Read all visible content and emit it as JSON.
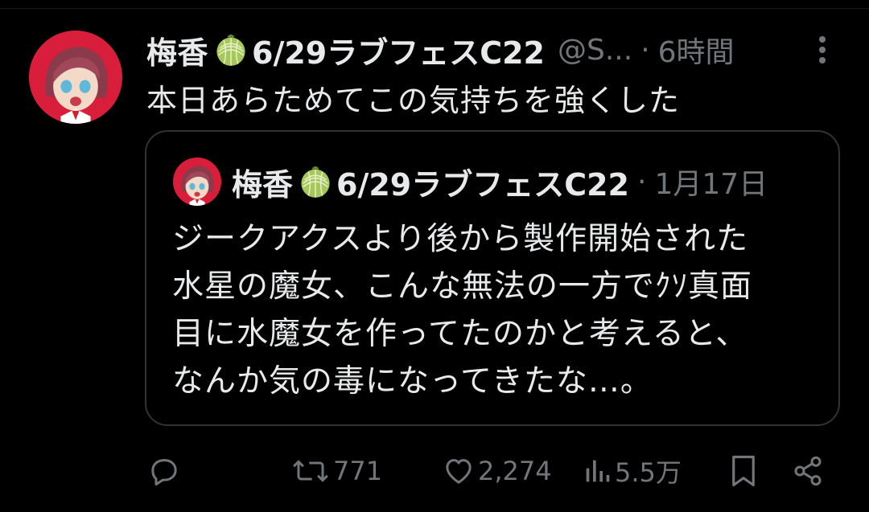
{
  "tweet": {
    "display_name": "梅香",
    "name_suffix": "6/29ラブフェスC22",
    "handle": "@S...",
    "time": "6時間",
    "separator": "·",
    "text": "本日あらためてこの気持ちを強くした"
  },
  "quote": {
    "display_name": "梅香",
    "name_suffix": "6/29ラブフェスC22",
    "separator": "·",
    "time": "1月17日",
    "lines": [
      "ジークアクスより後から製作開始された",
      "水星の魔女、こんな無法の一方でｸｿ真面",
      "目に水魔女を作ってたのかと考えると、",
      "なんか気の毒になってきたな…。"
    ]
  },
  "actions": {
    "reply_icon": "reply-icon",
    "retweet_icon": "retweet-icon",
    "retweet_count": "771",
    "like_icon": "heart-icon",
    "like_count": "2,274",
    "views_icon": "views-icon",
    "views_count": "5.5万",
    "bookmark_icon": "bookmark-icon",
    "share_icon": "share-icon"
  },
  "colors": {
    "background": "#000000",
    "text": "#e7e9ea",
    "secondary": "#71767b",
    "border": "#2f3336",
    "avatar_bg": "#d81e3a",
    "melon": "#a6c85a"
  }
}
